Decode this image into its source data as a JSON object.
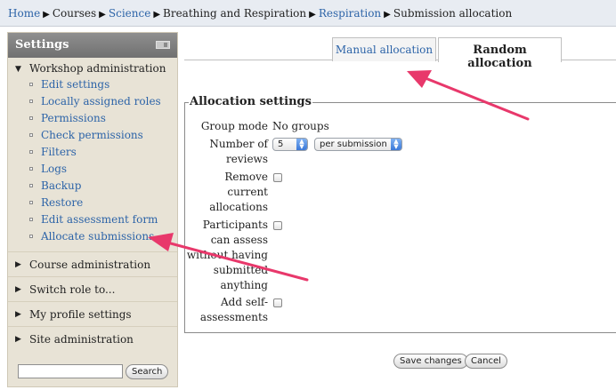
{
  "breadcrumb": {
    "items": [
      {
        "label": "Home",
        "link": true
      },
      {
        "label": "Courses",
        "link": false
      },
      {
        "label": "Science",
        "link": true
      },
      {
        "label": "Breathing and Respiration",
        "link": false
      },
      {
        "label": "Respiration",
        "link": true
      },
      {
        "label": "Submission allocation",
        "link": false
      }
    ],
    "separator": "▶"
  },
  "sidebar": {
    "title": "Settings",
    "workshop": {
      "label": "Workshop administration",
      "items": [
        "Edit settings",
        "Locally assigned roles",
        "Permissions",
        "Check permissions",
        "Filters",
        "Logs",
        "Backup",
        "Restore",
        "Edit assessment form",
        "Allocate submissions"
      ]
    },
    "sections": [
      "Course administration",
      "Switch role to...",
      "My profile settings",
      "Site administration"
    ],
    "search": {
      "value": "",
      "button": "Search"
    }
  },
  "tabs": [
    {
      "label": "Manual allocation",
      "active": false
    },
    {
      "label": "Random allocation",
      "active": true
    }
  ],
  "form": {
    "legend": "Allocation settings",
    "group_mode": {
      "label": "Group mode",
      "value": "No groups"
    },
    "number_of_reviews": {
      "label_1": "Number of",
      "label_2": "reviews",
      "count": "5",
      "mode": "per submission"
    },
    "remove_current": {
      "label_1": "Remove",
      "label_2": "current",
      "label_3": "allocations",
      "checked": false
    },
    "participants": {
      "label_1": "Participants",
      "label_2": "can assess",
      "label_3": "without having",
      "label_4": "submitted",
      "label_5": "anything",
      "checked": false
    },
    "self_assess": {
      "label_1": "Add self-",
      "label_2": "assessments",
      "checked": false
    }
  },
  "actions": {
    "save": "Save changes",
    "cancel": "Cancel"
  },
  "colors": {
    "link": "#2d64a8",
    "arrow": "#e8386b"
  }
}
